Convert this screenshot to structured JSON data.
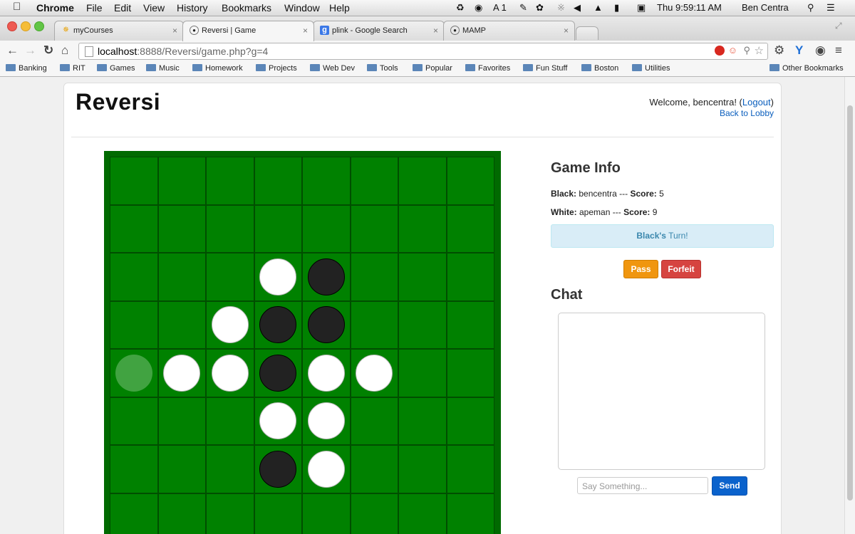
{
  "menubar": {
    "app": "Chrome",
    "items": [
      "File",
      "Edit",
      "View",
      "History",
      "Bookmarks",
      "Window",
      "Help"
    ],
    "status_a": "A 1",
    "clock": "Thu 9:59:11 AM",
    "user": "Ben Centra"
  },
  "tabs": [
    {
      "label": "myCourses",
      "icon": "star-icon"
    },
    {
      "label": "Reversi | Game",
      "icon": "globe-icon"
    },
    {
      "label": "plink - Google Search",
      "icon": "google-icon"
    },
    {
      "label": "MAMP",
      "icon": "globe-icon"
    }
  ],
  "address": {
    "host": "localhost",
    "path": ":8888/Reversi/game.php?g=4"
  },
  "bookmarks": [
    "Banking",
    "RIT",
    "Games",
    "Music",
    "Homework",
    "Projects",
    "Web Dev",
    "Tools",
    "Popular",
    "Favorites",
    "Fun Stuff",
    "Boston",
    "Utilities"
  ],
  "other_bookmarks": "Other Bookmarks",
  "header": {
    "logo": "Reversi",
    "welcome_prefix": "Welcome, bencentra! (",
    "logout": "Logout",
    "welcome_suffix": ")",
    "back_to_lobby": "Back to Lobby"
  },
  "board": {
    "pieces": [
      {
        "row": 2,
        "col": 3,
        "color": "white"
      },
      {
        "row": 2,
        "col": 4,
        "color": "black"
      },
      {
        "row": 3,
        "col": 2,
        "color": "white"
      },
      {
        "row": 3,
        "col": 3,
        "color": "black"
      },
      {
        "row": 3,
        "col": 4,
        "color": "black"
      },
      {
        "row": 4,
        "col": 0,
        "color": "hint"
      },
      {
        "row": 4,
        "col": 1,
        "color": "white"
      },
      {
        "row": 4,
        "col": 2,
        "color": "white"
      },
      {
        "row": 4,
        "col": 3,
        "color": "black"
      },
      {
        "row": 4,
        "col": 4,
        "color": "white"
      },
      {
        "row": 4,
        "col": 5,
        "color": "white"
      },
      {
        "row": 5,
        "col": 3,
        "color": "white"
      },
      {
        "row": 5,
        "col": 4,
        "color": "white"
      },
      {
        "row": 6,
        "col": 3,
        "color": "black"
      },
      {
        "row": 6,
        "col": 4,
        "color": "white"
      }
    ]
  },
  "game_info": {
    "title": "Game Info",
    "black_label": "Black:",
    "black_player": "bencentra",
    "sep": "---",
    "score_label": "Score:",
    "black_score": "5",
    "white_label": "White:",
    "white_player": "apeman",
    "white_score": "9",
    "turn_player": "Black's",
    "turn_text": "Turn!",
    "pass": "Pass",
    "forfeit": "Forfeit"
  },
  "chat": {
    "title": "Chat",
    "placeholder": "Say Something...",
    "send": "Send"
  },
  "colors": {
    "board": "#008100",
    "send": "#0a62cc",
    "pass": "#f0960f",
    "forfeit": "#d64440",
    "turn_bg": "#d9edf7"
  }
}
